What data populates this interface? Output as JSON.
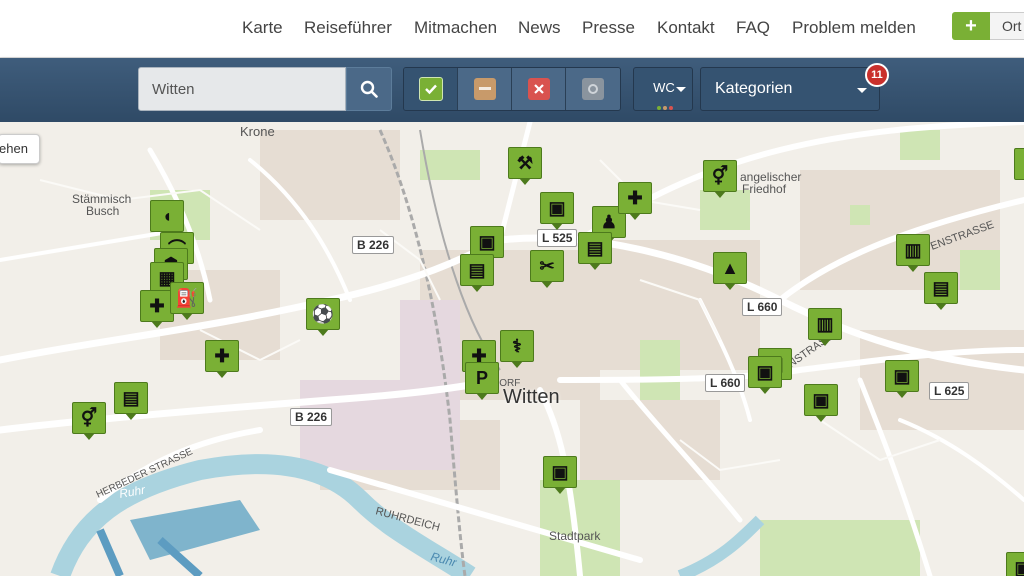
{
  "nav": {
    "items": [
      "Karte",
      "Reiseführer",
      "Mitmachen",
      "News",
      "Presse",
      "Kontakt",
      "FAQ",
      "Problem melden"
    ],
    "add_label": "+",
    "ort_label": "Ort"
  },
  "toolbar": {
    "search_value": "Witten",
    "filters": [
      "yes",
      "limited",
      "no",
      "unknown"
    ],
    "wc_label": "WC",
    "kategorien_label": "Kategorien",
    "kategorien_badge": "11"
  },
  "colors": {
    "brand_green": "#7ab035",
    "toolbar_blue": "#3f5d7c",
    "badge_red": "#c9302c",
    "limited_orange": "#c89a6a",
    "no_red": "#d9534f",
    "unknown_grey": "#8a949e"
  },
  "map": {
    "location_button_label": "ehen",
    "city_label": "Witten",
    "place_labels": [
      "Krone",
      "Stämmisch",
      "Busch",
      "angelischer",
      "Friedhof",
      "Stadtpark",
      "Ruhr",
      "Ruhr",
      "HERBEDER STRASSE",
      "RUHRDEICH",
      "ENSTRASSE",
      "ENSTRASSE",
      "DORF"
    ],
    "road_shields": [
      "B 226",
      "B 226",
      "L 525",
      "L 660",
      "L 660",
      "L 625"
    ],
    "markers": [
      "bakery-icon",
      "wifi-icon",
      "toilet-icon",
      "pharmacy-icon",
      "supermarket-icon",
      "medical-plus-icon",
      "fuel-icon",
      "sports-icon",
      "medical-plus-icon",
      "atm-icon",
      "toilet-icon",
      "tools-icon",
      "bus-stop-icon",
      "bus-stop-icon",
      "atm-icon",
      "hairdresser-icon",
      "atm-icon",
      "person-icon",
      "medical-plus-icon",
      "toilet-icon",
      "fuel-station-icon",
      "medical-plus-icon",
      "parking-icon",
      "doctor-icon",
      "bus-stop-icon",
      "train-icon",
      "shop-icon",
      "train-icon",
      "bus-stop-icon",
      "bus-stop-icon",
      "bus-stop-icon",
      "bus-stop-icon"
    ]
  }
}
